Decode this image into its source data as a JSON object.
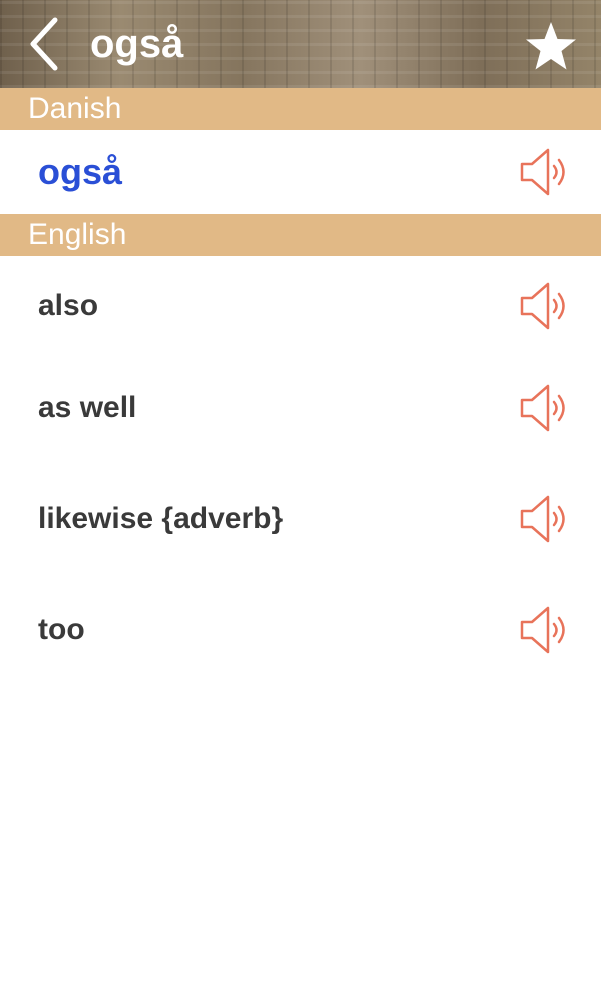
{
  "header": {
    "title": "også"
  },
  "source_section": {
    "label": "Danish",
    "word": "også"
  },
  "target_section": {
    "label": "English",
    "translations": [
      {
        "text": "also"
      },
      {
        "text": "as well"
      },
      {
        "text": "likewise {adverb}"
      },
      {
        "text": "too"
      }
    ]
  },
  "colors": {
    "section_header": "#e1b986",
    "source_word": "#2a4fd6",
    "speaker_icon": "#e8735a",
    "translation_text": "#3a3a3a"
  },
  "icons": {
    "back": "chevron-left-icon",
    "favorite": "star-icon",
    "speaker": "speaker-icon"
  }
}
